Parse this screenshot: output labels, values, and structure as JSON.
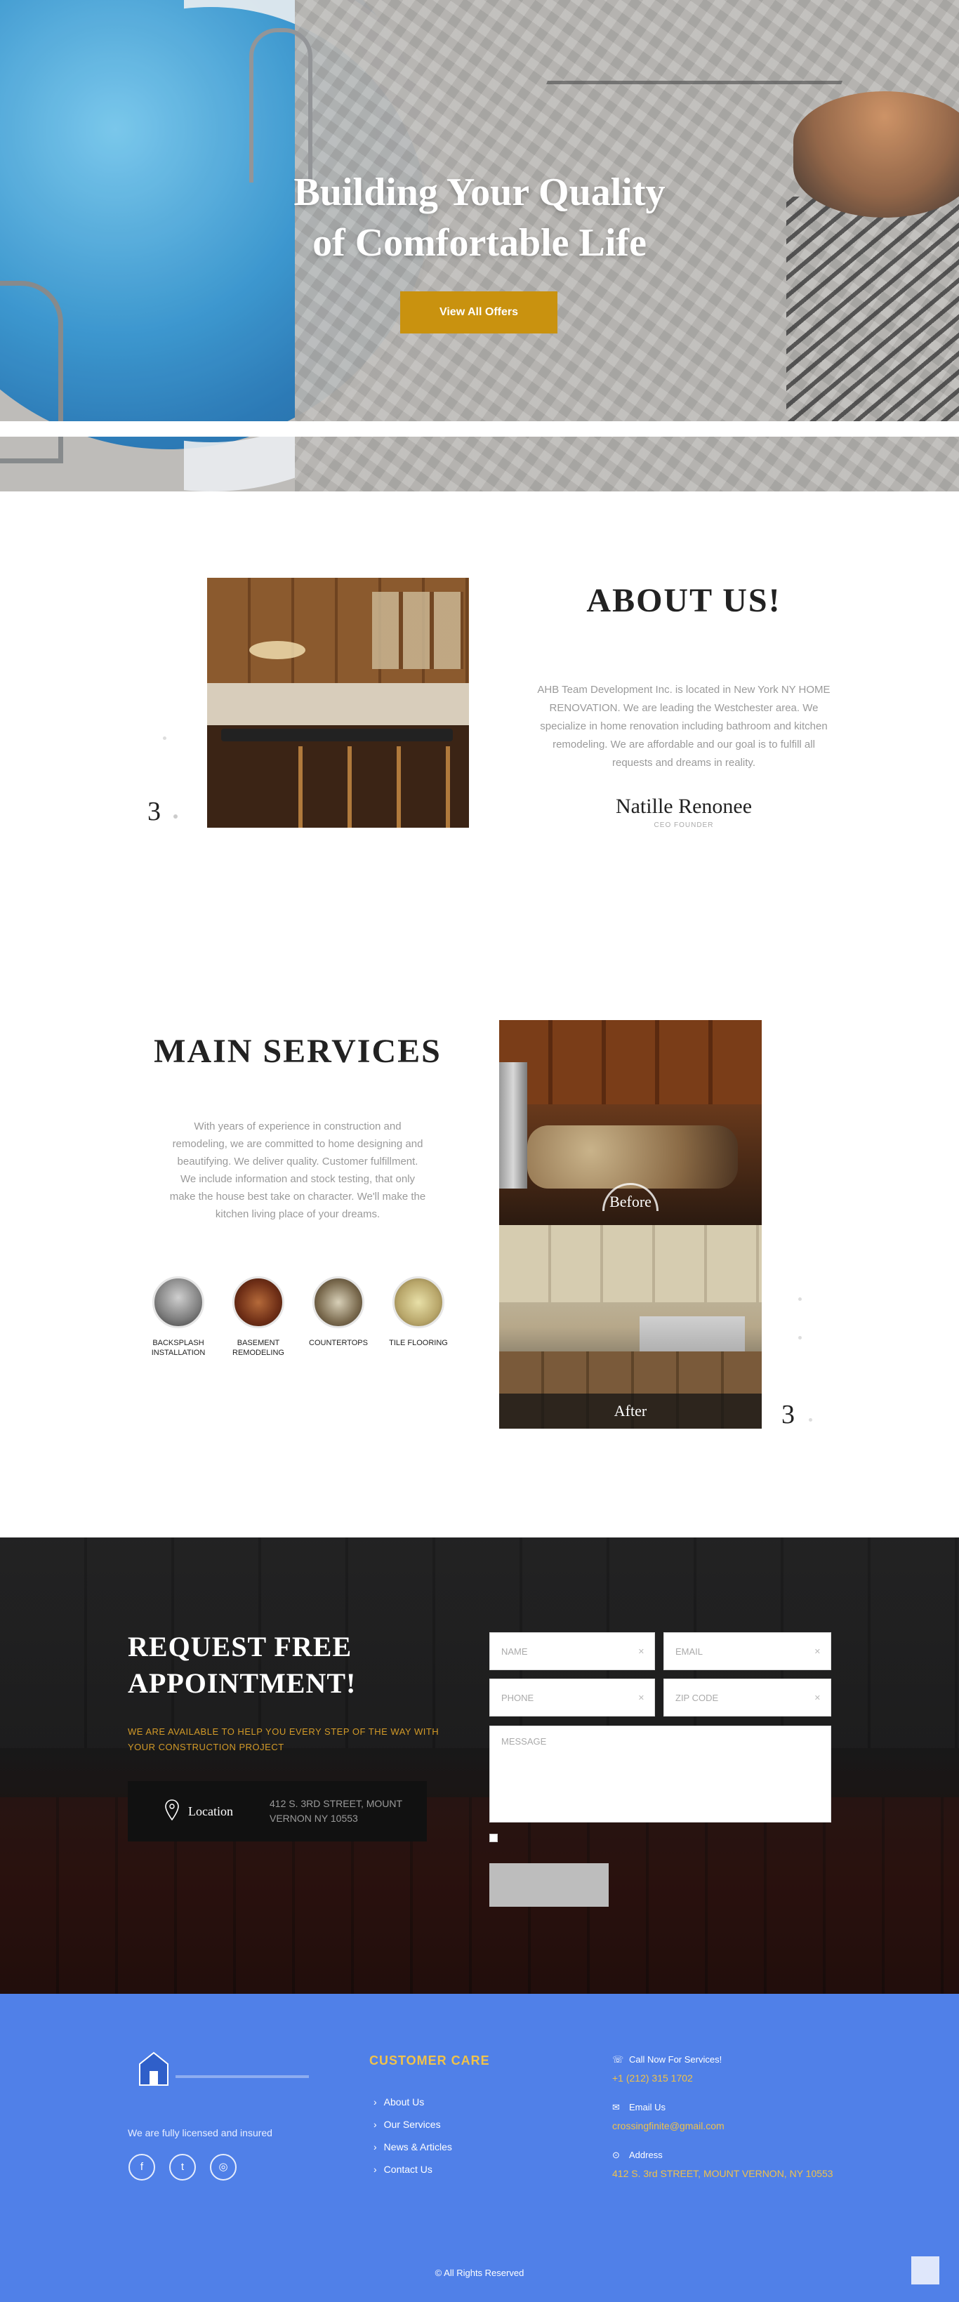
{
  "hero": {
    "title_line1": "Building Your Quality",
    "title_line2": "of Comfortable Life",
    "cta": "View All Offers",
    "accent": "#c9920f"
  },
  "about": {
    "title": "ABOUT US!",
    "text": "AHB Team Development Inc. is located in New York NY HOME RENOVATION. We are leading the Westchester area. We specialize in home renovation including bathroom and kitchen remodeling. We are affordable and our goal is to fulfill all requests and dreams in reality.",
    "signature": "Natille Renonee",
    "role": "CEO FOUNDER",
    "slide_number": "3"
  },
  "services": {
    "title": "MAIN SERVICES",
    "text": "With years of experience in construction and remodeling, we are committed to home designing and beautifying. We deliver quality. Customer fulfillment. We include information and stock testing, that only make the house best take on character. We'll make the kitchen living place of your dreams.",
    "items": [
      {
        "label": "BACKSPLASH INSTALLATION",
        "icon": "backsplash-icon"
      },
      {
        "label": "BASEMENT REMODELING",
        "icon": "basement-icon"
      },
      {
        "label": "COUNTERTOPS",
        "icon": "countertops-icon"
      },
      {
        "label": "TILE FLOORING",
        "icon": "tile-flooring-icon"
      }
    ],
    "before_label": "Before",
    "after_label": "After",
    "slide_number": "3"
  },
  "appointment": {
    "title_line1": "REQUEST FREE",
    "title_line2": "APPOINTMENT!",
    "subtitle": "WE ARE AVAILABLE TO HELP YOU EVERY STEP OF THE WAY WITH YOUR CONSTRUCTION PROJECT",
    "location_label": "Location",
    "location_address": "412 S. 3rd Street, MOUNT VERNON NY 10553",
    "fields": {
      "name": "NAME",
      "email": "EMAIL",
      "phone": "PHONE",
      "zip": "ZIP CODE",
      "message": "MESSAGE"
    }
  },
  "footer": {
    "about": "We are fully licensed and insured",
    "customer_care_title": "CUSTOMER CARE",
    "links": [
      "About Us",
      "Our Services",
      "News & Articles",
      "Contact Us"
    ],
    "phone_label": "Call Now For Services!",
    "phone": "+1 (212) 315 1702",
    "email_label": "Email Us",
    "email": "crossingfinite@gmail.com",
    "address_label": "Address",
    "address": "412 S. 3rd STREET, MOUNT VERNON, NY 10553",
    "copyright": "© All Rights Reserved",
    "bg": "#5080e8",
    "accent": "#f0c24a"
  }
}
